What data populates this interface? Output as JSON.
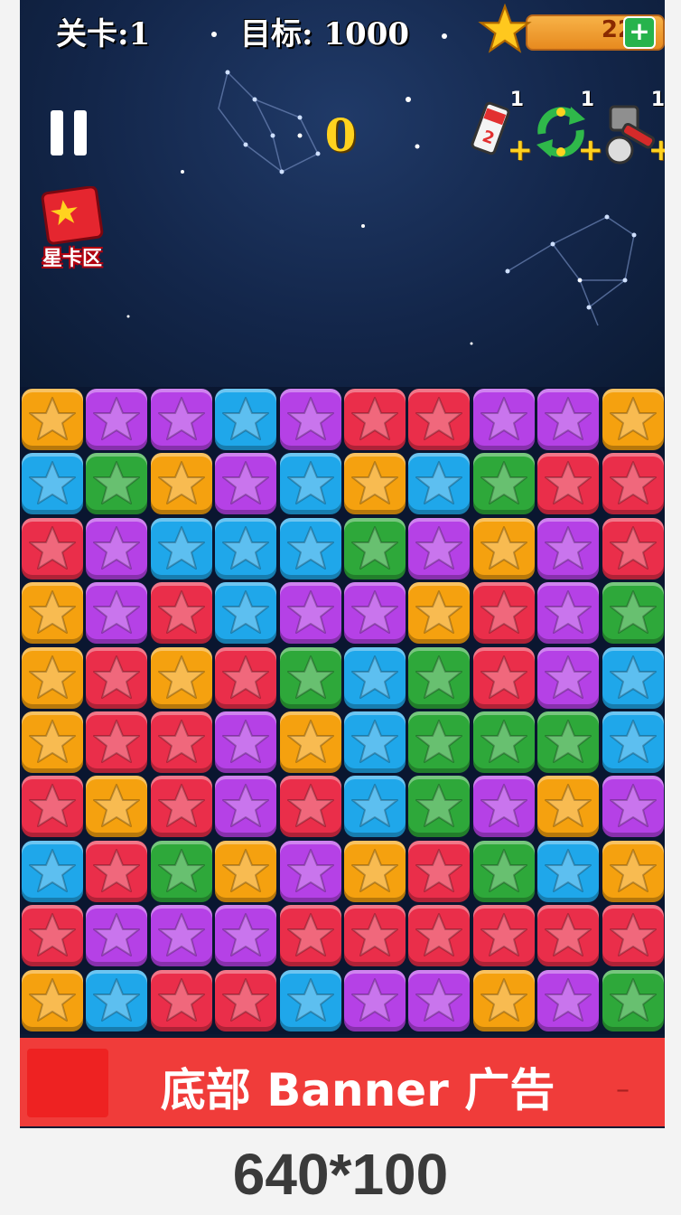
{
  "hud": {
    "level_label": "关卡:1",
    "target_label": "目标: 1000",
    "coin_count": "22",
    "plus_label": "+",
    "score": "0"
  },
  "tools": [
    {
      "name": "brush-tool-icon",
      "count": "1",
      "plus": "+"
    },
    {
      "name": "refresh-tool-icon",
      "count": "1",
      "plus": "+"
    },
    {
      "name": "hammer-tool-icon",
      "count": "1",
      "plus": "+"
    }
  ],
  "card_album": {
    "label": "星卡区"
  },
  "colors": {
    "Y": "#f5a10f",
    "P": "#b541e6",
    "B": "#1fa7ea",
    "G": "#2ea83a",
    "R": "#ea2e4a"
  },
  "board": [
    [
      "Y",
      "P",
      "P",
      "B",
      "P",
      "R",
      "R",
      "P",
      "P",
      "Y"
    ],
    [
      "B",
      "G",
      "Y",
      "P",
      "B",
      "Y",
      "B",
      "G",
      "R",
      "R"
    ],
    [
      "R",
      "P",
      "B",
      "B",
      "B",
      "G",
      "P",
      "Y",
      "P",
      "R"
    ],
    [
      "Y",
      "P",
      "R",
      "B",
      "P",
      "P",
      "Y",
      "R",
      "P",
      "G"
    ],
    [
      "Y",
      "R",
      "Y",
      "R",
      "G",
      "B",
      "G",
      "R",
      "P",
      "B"
    ],
    [
      "Y",
      "R",
      "R",
      "P",
      "Y",
      "B",
      "G",
      "G",
      "G",
      "B"
    ],
    [
      "R",
      "Y",
      "R",
      "P",
      "R",
      "B",
      "G",
      "P",
      "Y",
      "P"
    ],
    [
      "B",
      "R",
      "G",
      "Y",
      "P",
      "Y",
      "R",
      "G",
      "B",
      "Y"
    ],
    [
      "R",
      "P",
      "P",
      "P",
      "R",
      "R",
      "R",
      "R",
      "R",
      "R"
    ],
    [
      "Y",
      "B",
      "R",
      "R",
      "B",
      "P",
      "P",
      "Y",
      "P",
      "G"
    ]
  ],
  "banner": {
    "text": "底部 Banner 广告"
  },
  "size_label": "640*100"
}
